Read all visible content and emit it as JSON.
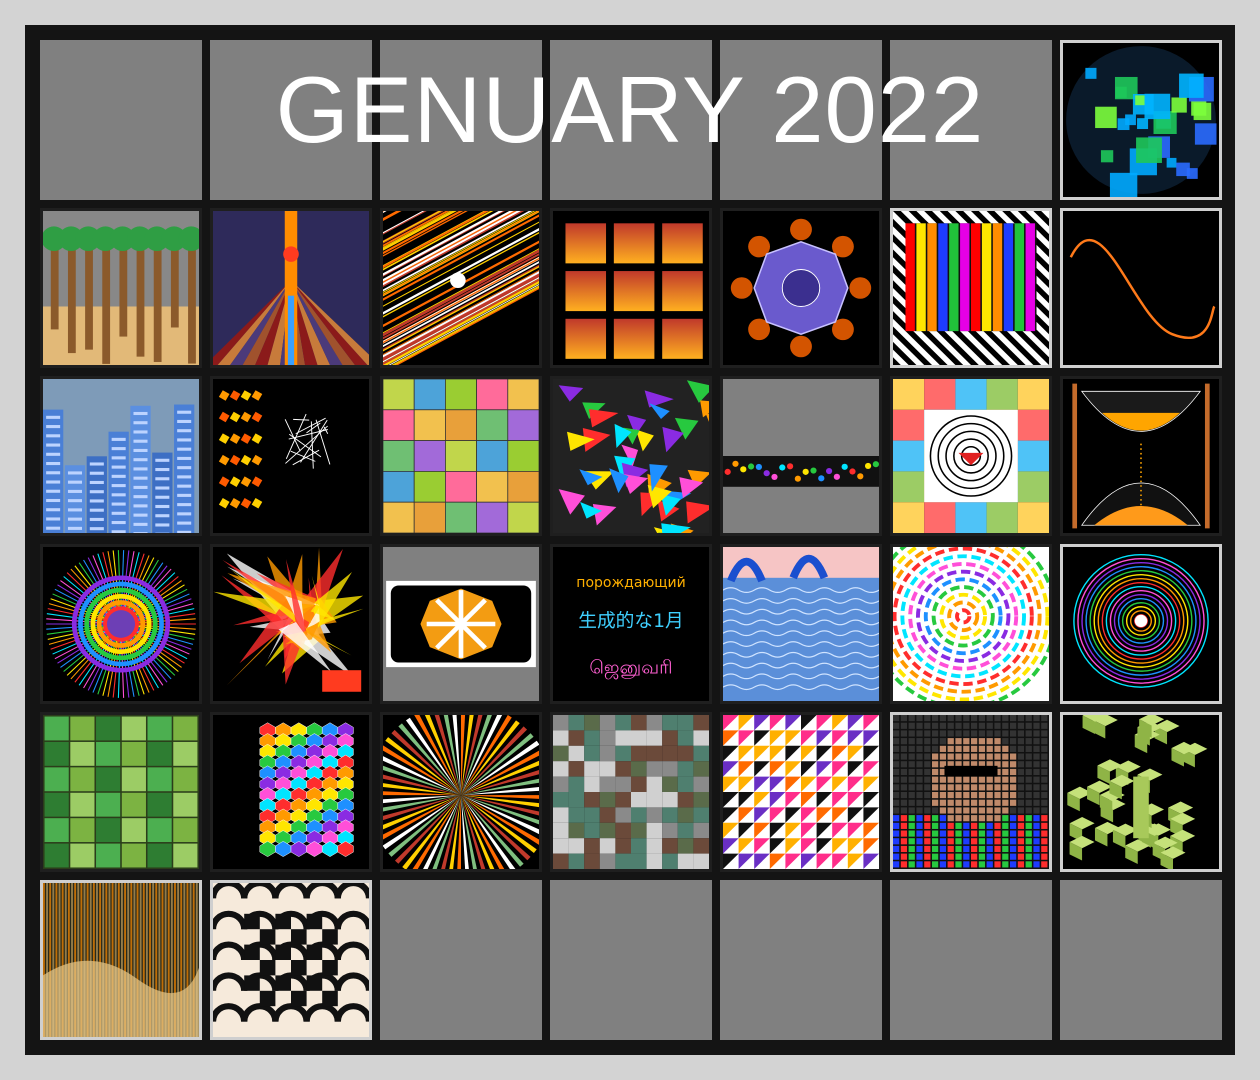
{
  "title": "GENUARY 2022",
  "colors": {
    "page": "#d3d3d3",
    "board": "#141414",
    "empty_cell": "#808080",
    "title": "#ffffff"
  },
  "day29": {
    "line1": "порождающий",
    "line2": "生成的な1月",
    "line3": "ஜெனுவரி"
  }
}
